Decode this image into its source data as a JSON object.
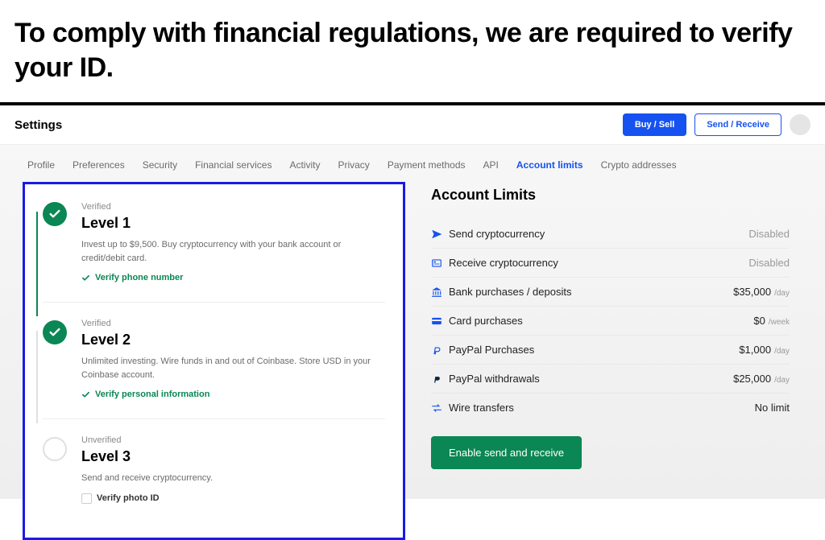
{
  "headline": "To comply with financial regulations, we are required to verify your ID.",
  "topbar": {
    "title": "Settings",
    "buy_sell": "Buy / Sell",
    "send_receive": "Send / Receive"
  },
  "tabs": [
    "Profile",
    "Preferences",
    "Security",
    "Financial services",
    "Activity",
    "Privacy",
    "Payment methods",
    "API",
    "Account limits",
    "Crypto addresses"
  ],
  "active_tab": "Account limits",
  "levels": [
    {
      "status": "Verified",
      "title": "Level 1",
      "desc": "Invest up to $9,500. Buy cryptocurrency with your bank account or credit/debit card.",
      "action": "Verify phone number",
      "done": true
    },
    {
      "status": "Verified",
      "title": "Level 2",
      "desc": "Unlimited investing. Wire funds in and out of Coinbase. Store USD in your Coinbase account.",
      "action": "Verify personal information",
      "done": true
    },
    {
      "status": "Unverified",
      "title": "Level 3",
      "desc": "Send and receive cryptocurrency.",
      "action": "Verify photo ID",
      "done": false
    }
  ],
  "limits": {
    "title": "Account Limits",
    "rows": [
      {
        "icon": "send",
        "label": "Send cryptocurrency",
        "value": "Disabled",
        "unit": "",
        "dimmed": true
      },
      {
        "icon": "receive",
        "label": "Receive cryptocurrency",
        "value": "Disabled",
        "unit": "",
        "dimmed": true
      },
      {
        "icon": "bank",
        "label": "Bank purchases / deposits",
        "value": "$35,000",
        "unit": "/day",
        "dimmed": false
      },
      {
        "icon": "card",
        "label": "Card purchases",
        "value": "$0",
        "unit": "/week",
        "dimmed": false
      },
      {
        "icon": "paypal",
        "label": "PayPal Purchases",
        "value": "$1,000",
        "unit": "/day",
        "dimmed": false
      },
      {
        "icon": "paypal-bold",
        "label": "PayPal withdrawals",
        "value": "$25,000",
        "unit": "/day",
        "dimmed": false
      },
      {
        "icon": "wire",
        "label": "Wire transfers",
        "value": "No limit",
        "unit": "",
        "dimmed": false
      }
    ],
    "enable_btn": "Enable send and receive"
  }
}
